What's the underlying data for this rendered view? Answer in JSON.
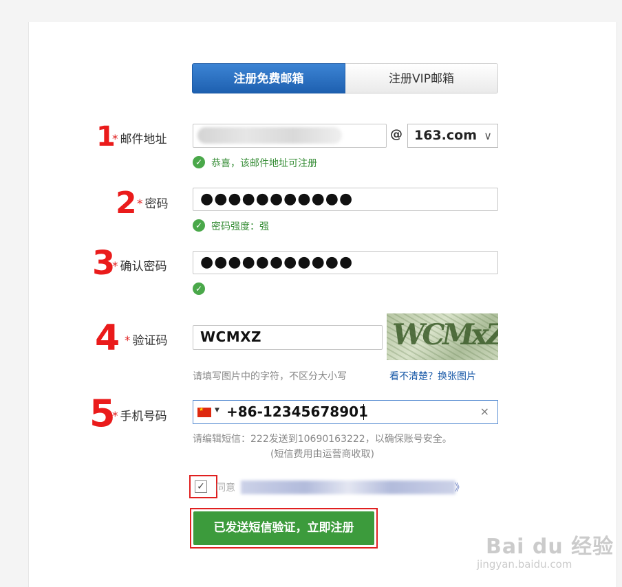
{
  "tabs": {
    "free": "注册免费邮箱",
    "vip": "注册VIP邮箱"
  },
  "email": {
    "label": "邮件地址",
    "required_mark": "*",
    "at": "@",
    "domain": "163.com",
    "hint": "恭喜，该邮件地址可注册"
  },
  "password": {
    "label": "密码",
    "required_mark": "*",
    "value_masked": "●●●●●●●●●●●",
    "hint": "密码强度：强"
  },
  "confirm_password": {
    "label": "确认密码",
    "required_mark": "*",
    "value_masked": "●●●●●●●●●●●"
  },
  "captcha": {
    "label": "验证码",
    "required_mark": "*",
    "value": "WCMXZ",
    "image_text": "WCMxZ",
    "hint": "请填写图片中的字符，不区分大小写",
    "refresh_link": "看不清楚？换张图片"
  },
  "phone": {
    "label": "手机号码",
    "required_mark": "*",
    "value": "+86-12345678901",
    "clear": "×",
    "hint_line1": "请编辑短信：222发送到10690163222，以确保账号安全。",
    "hint_line2": "(短信费用由运营商收取)"
  },
  "agree": {
    "checked": true,
    "text": "同意",
    "close_mark": "》"
  },
  "submit": {
    "label": "已发送短信验证，立即注册"
  },
  "annotations": [
    "1",
    "2",
    "3",
    "4",
    "5"
  ],
  "watermark": {
    "logo": "Bai du 经验",
    "url": "jingyan.baidu.com"
  },
  "colors": {
    "accent_blue": "#1e60b0",
    "submit_green": "#3c9b3c",
    "annotation_red": "#ea1b1b",
    "success_green": "#4aa84a"
  }
}
